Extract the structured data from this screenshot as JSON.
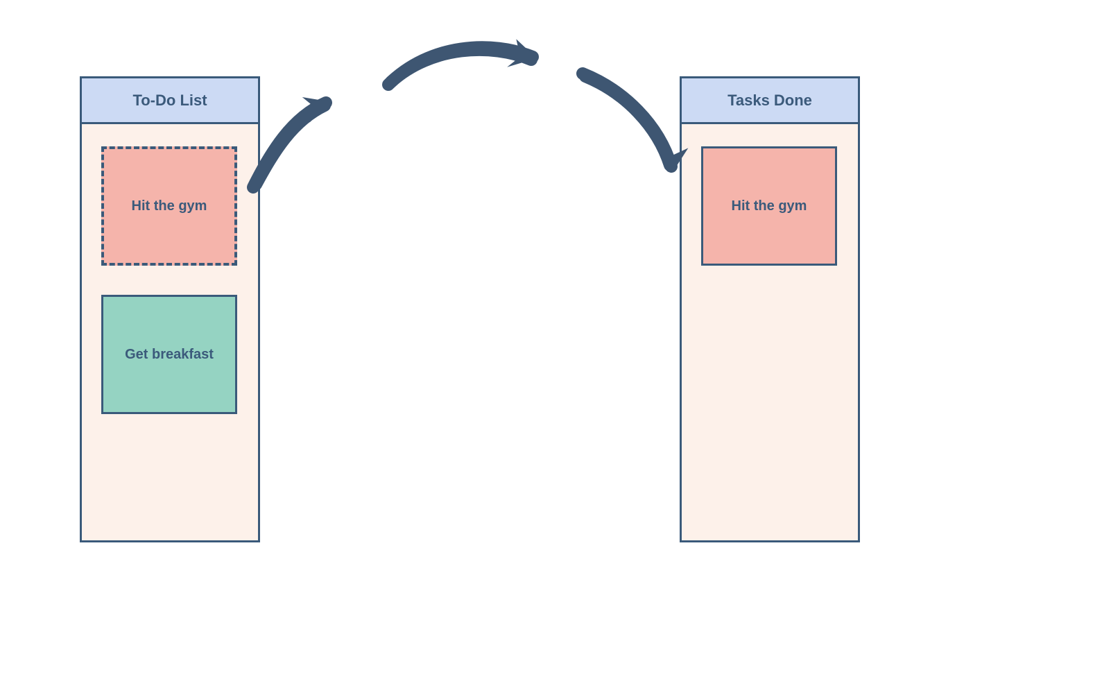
{
  "columns": {
    "todo": {
      "title": "To-Do List",
      "cards": [
        {
          "label": "Hit the gym",
          "style": "dashed-pink"
        },
        {
          "label": "Get breakfast",
          "style": "solid-teal"
        }
      ]
    },
    "done": {
      "title": "Tasks Done",
      "cards": [
        {
          "label": "Hit the gym",
          "style": "solid-pink"
        }
      ]
    }
  },
  "colors": {
    "border": "#3a5a7a",
    "text": "#3b5a7b",
    "header_bg": "#ccdaf4",
    "column_bg": "#fdf1ea",
    "card_pink": "#f5b4ab",
    "card_teal": "#95d3c2",
    "arrow": "#3e5672"
  }
}
